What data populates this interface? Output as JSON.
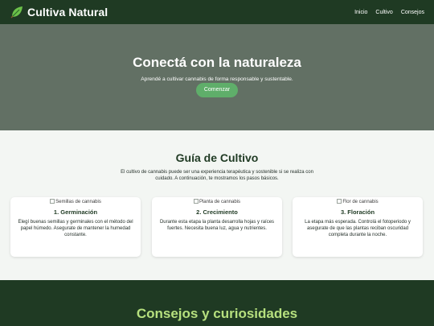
{
  "header": {
    "brand_name": "Cultiva Natural",
    "brand_icon": "leaf-icon",
    "nav": [
      "Inicio",
      "Cultivo",
      "Consejos"
    ]
  },
  "hero": {
    "title": "Conectá con la naturaleza",
    "subtitle": "Aprendé a cultivar cannabis de forma responsable y sustentable.",
    "button": "Comenzar"
  },
  "guide": {
    "title": "Guía de Cultivo",
    "intro": "El cultivo de cannabis puede ser una experiencia terapéutica y sostenible si se realiza con cuidado. A continuación, te mostramos los pasos básicos.",
    "cards": [
      {
        "img_alt": "Semillas de cannabis",
        "title": "1. Germinación",
        "text": "Elegí buenas semillas y germinales con el método del papel húmedo. Asegurate de mantener la humedad constante."
      },
      {
        "img_alt": "Planta de cannabis",
        "title": "2. Crecimiento",
        "text": "Durante esta etapa la planta desarrolla hojas y raíces fuertes. Necesita buena luz, agua y nutrientes."
      },
      {
        "img_alt": "Flor de cannabis",
        "title": "3. Floración",
        "text": "La etapa más esperada. Controlá el fotoperiodo y asegurate de que las plantas reciban oscuridad completa durante la noche."
      }
    ]
  },
  "tips": {
    "title": "Consejos y curiosidades"
  },
  "colors": {
    "header_bg": "#1f3a23",
    "hero_bg": "#627064",
    "button_bg": "#5fae6a",
    "tips_title": "#b6e07e"
  }
}
